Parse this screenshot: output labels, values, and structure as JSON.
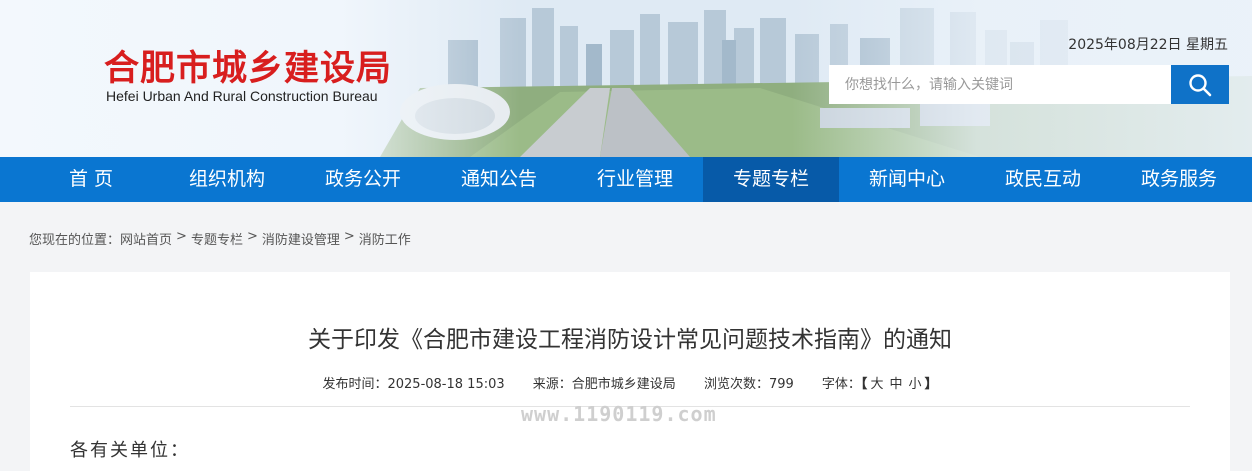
{
  "header": {
    "logo_cn": "合肥市城乡建设局",
    "logo_en": "Hefei Urban And Rural Construction Bureau",
    "date": "2025年08月22日 星期五",
    "search_placeholder": "你想找什么，请输入关键词",
    "search_icon": "search-icon"
  },
  "nav": {
    "items": [
      {
        "label": "首 页"
      },
      {
        "label": "组织机构"
      },
      {
        "label": "政务公开"
      },
      {
        "label": "通知公告"
      },
      {
        "label": "行业管理"
      },
      {
        "label": "专题专栏",
        "active": true
      },
      {
        "label": "新闻中心"
      },
      {
        "label": "政民互动"
      },
      {
        "label": "政务服务"
      }
    ]
  },
  "breadcrumb": {
    "prefix": "您现在的位置：",
    "items": [
      "网站首页",
      "专题专栏",
      "消防建设管理",
      "消防工作"
    ],
    "separator": ">"
  },
  "article": {
    "title": "关于印发《合肥市建设工程消防设计常见问题技术指南》的通知",
    "publish_time": "发布时间：2025-08-18 15:03",
    "source": "来源：合肥市城乡建设局",
    "views": "浏览次数：799",
    "font_label": "字体：",
    "font_open": "【",
    "font_large": "大",
    "font_medium": "中",
    "font_small": "小",
    "font_close": "】",
    "watermark": "www.1190119.com",
    "salutation": "各有关单位："
  },
  "colors": {
    "brand_red": "#d81e1e",
    "nav_blue": "#0a76d1",
    "nav_active": "#075aa8",
    "search_button": "#0f72c8"
  }
}
